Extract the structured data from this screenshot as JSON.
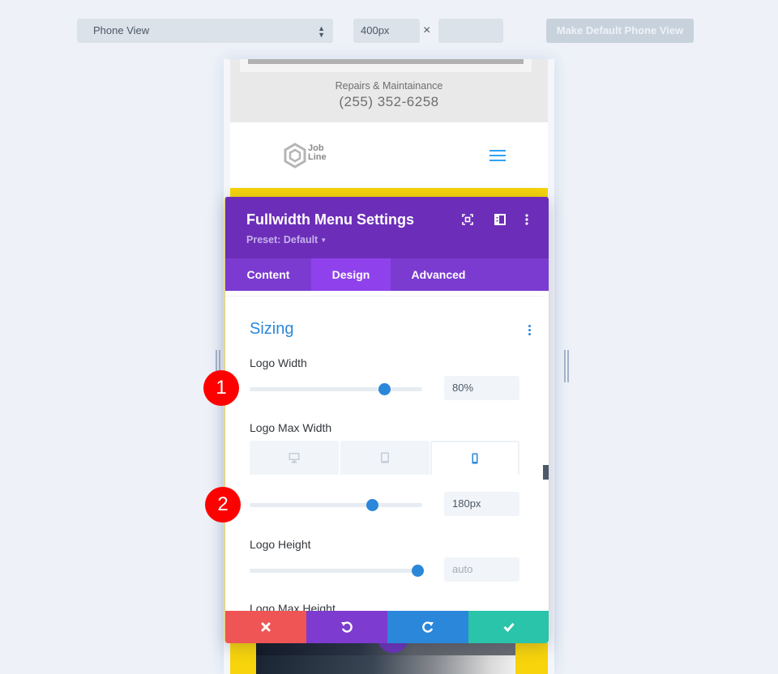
{
  "toolbar": {
    "view_select": "Phone View",
    "width_value": "400px",
    "height_value": "",
    "times_symbol": "×",
    "make_default_label": "Make Default Phone View"
  },
  "preview": {
    "tagline": "Repairs & Maintainance",
    "phone": "(255) 352-6258",
    "logo_line1": "Job",
    "logo_line2": "Line"
  },
  "modal": {
    "title": "Fullwidth Menu Settings",
    "preset": "Preset: Default",
    "tabs": [
      {
        "label": "Content",
        "active": false
      },
      {
        "label": "Design",
        "active": true
      },
      {
        "label": "Advanced",
        "active": false
      }
    ],
    "section_title": "Sizing",
    "fields": {
      "logo_width": {
        "label": "Logo Width",
        "value": "80%",
        "slider_fraction": 0.78
      },
      "logo_max_width": {
        "label": "Logo Max Width",
        "value": "180px",
        "slider_fraction": 0.71,
        "devices": [
          "desktop",
          "tablet",
          "phone"
        ],
        "active_device": "phone"
      },
      "logo_height": {
        "label": "Logo Height",
        "value": "auto",
        "slider_fraction": 0.97
      },
      "logo_max_height": {
        "label": "Logo Max Height"
      }
    },
    "actions": [
      "cancel",
      "undo",
      "redo",
      "save"
    ]
  },
  "badges": [
    "1",
    "2"
  ],
  "colors": {
    "header_purple": "#6c2eb9",
    "tab_purple": "#7b3bd1",
    "active_tab": "#8f42ec",
    "accent_blue": "#2b87da",
    "cancel_red": "#ef5555",
    "save_green": "#29c4a9",
    "badge_red": "#ff0000",
    "yellow": "#f7d40b"
  }
}
